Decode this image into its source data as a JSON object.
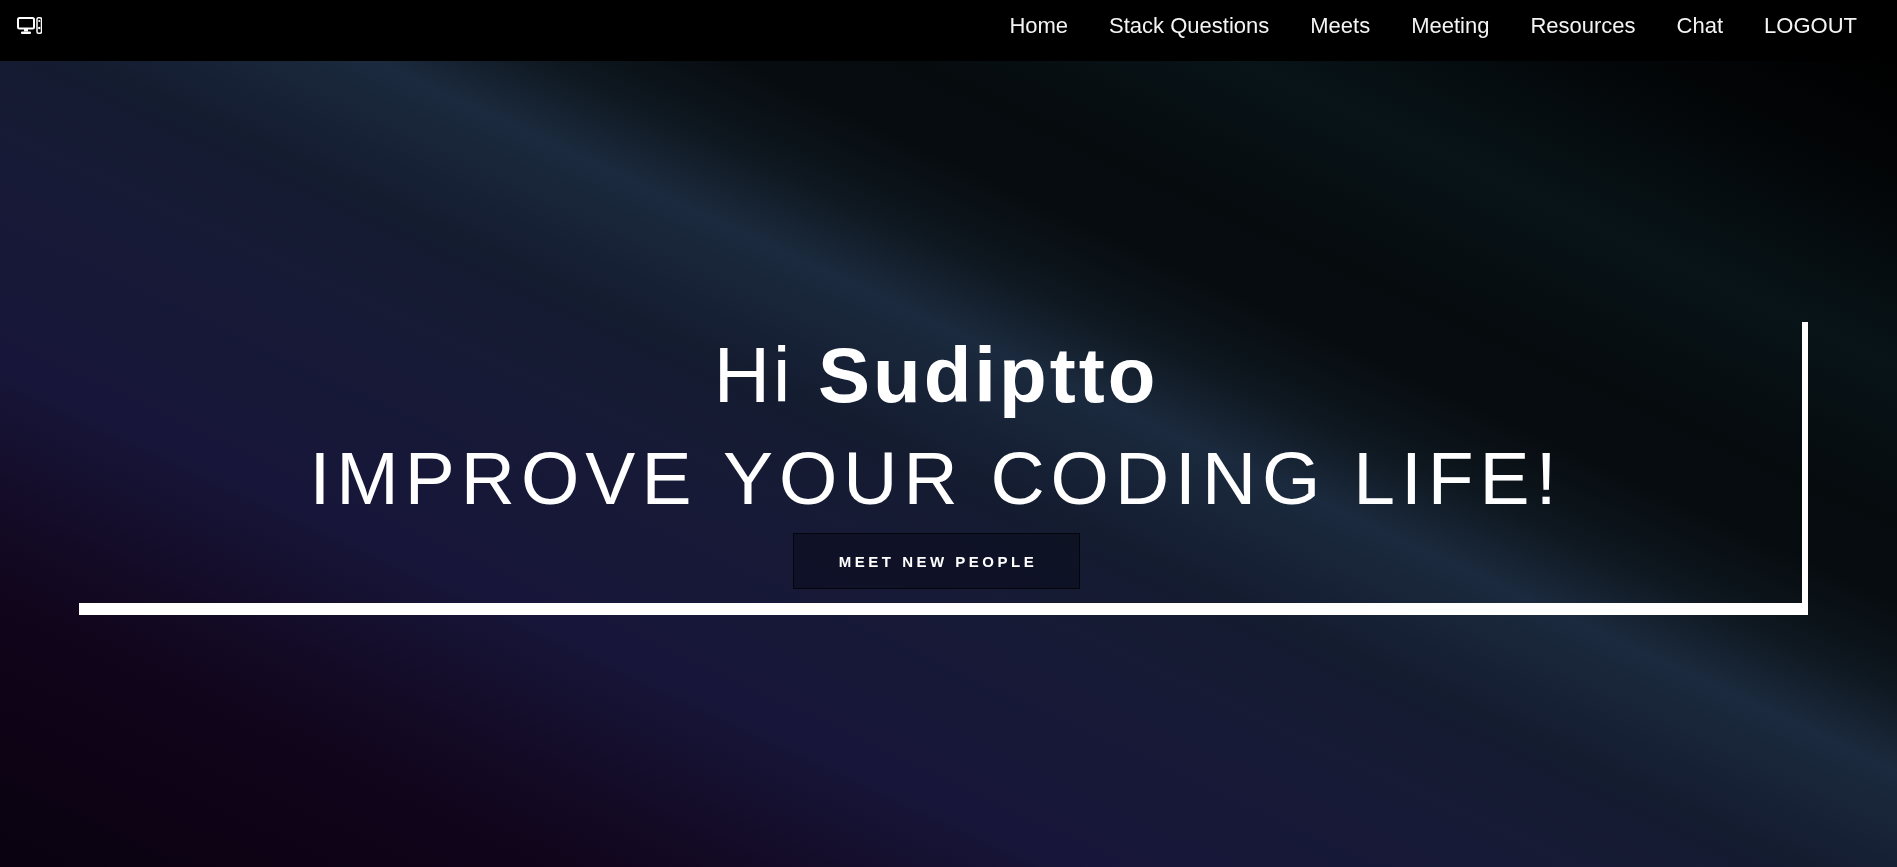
{
  "navbar": {
    "links": [
      "Home",
      "Stack Questions",
      "Meets",
      "Meeting",
      "Resources",
      "Chat",
      "LOGOUT"
    ]
  },
  "hero": {
    "greeting": "Hi **Sudiptto**",
    "tagline": "IMPROVE YOUR CODING LIFE!",
    "button": "MEET NEW PEOPLE"
  }
}
